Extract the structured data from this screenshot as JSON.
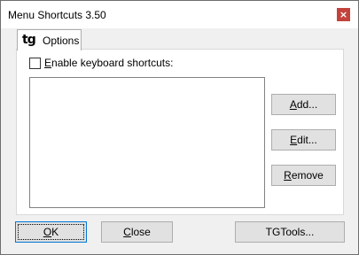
{
  "window": {
    "title": "Menu Shortcuts 3.50",
    "close_glyph": "×"
  },
  "tab": {
    "logo": "tg",
    "label": "Options"
  },
  "options": {
    "enable_shortcuts": {
      "label_prefix": "E",
      "label_rest": "nable keyboard shortcuts:",
      "checked": false
    },
    "shortcuts_list": []
  },
  "side_buttons": {
    "add": {
      "accel": "A",
      "rest": "dd..."
    },
    "edit": {
      "accel": "E",
      "rest": "dit..."
    },
    "remove": {
      "accel": "R",
      "rest": "emove"
    }
  },
  "footer": {
    "ok": {
      "accel": "O",
      "rest": "K"
    },
    "close": {
      "accel": "C",
      "rest": "lose"
    },
    "tgtools": {
      "label": "TGTools..."
    }
  }
}
